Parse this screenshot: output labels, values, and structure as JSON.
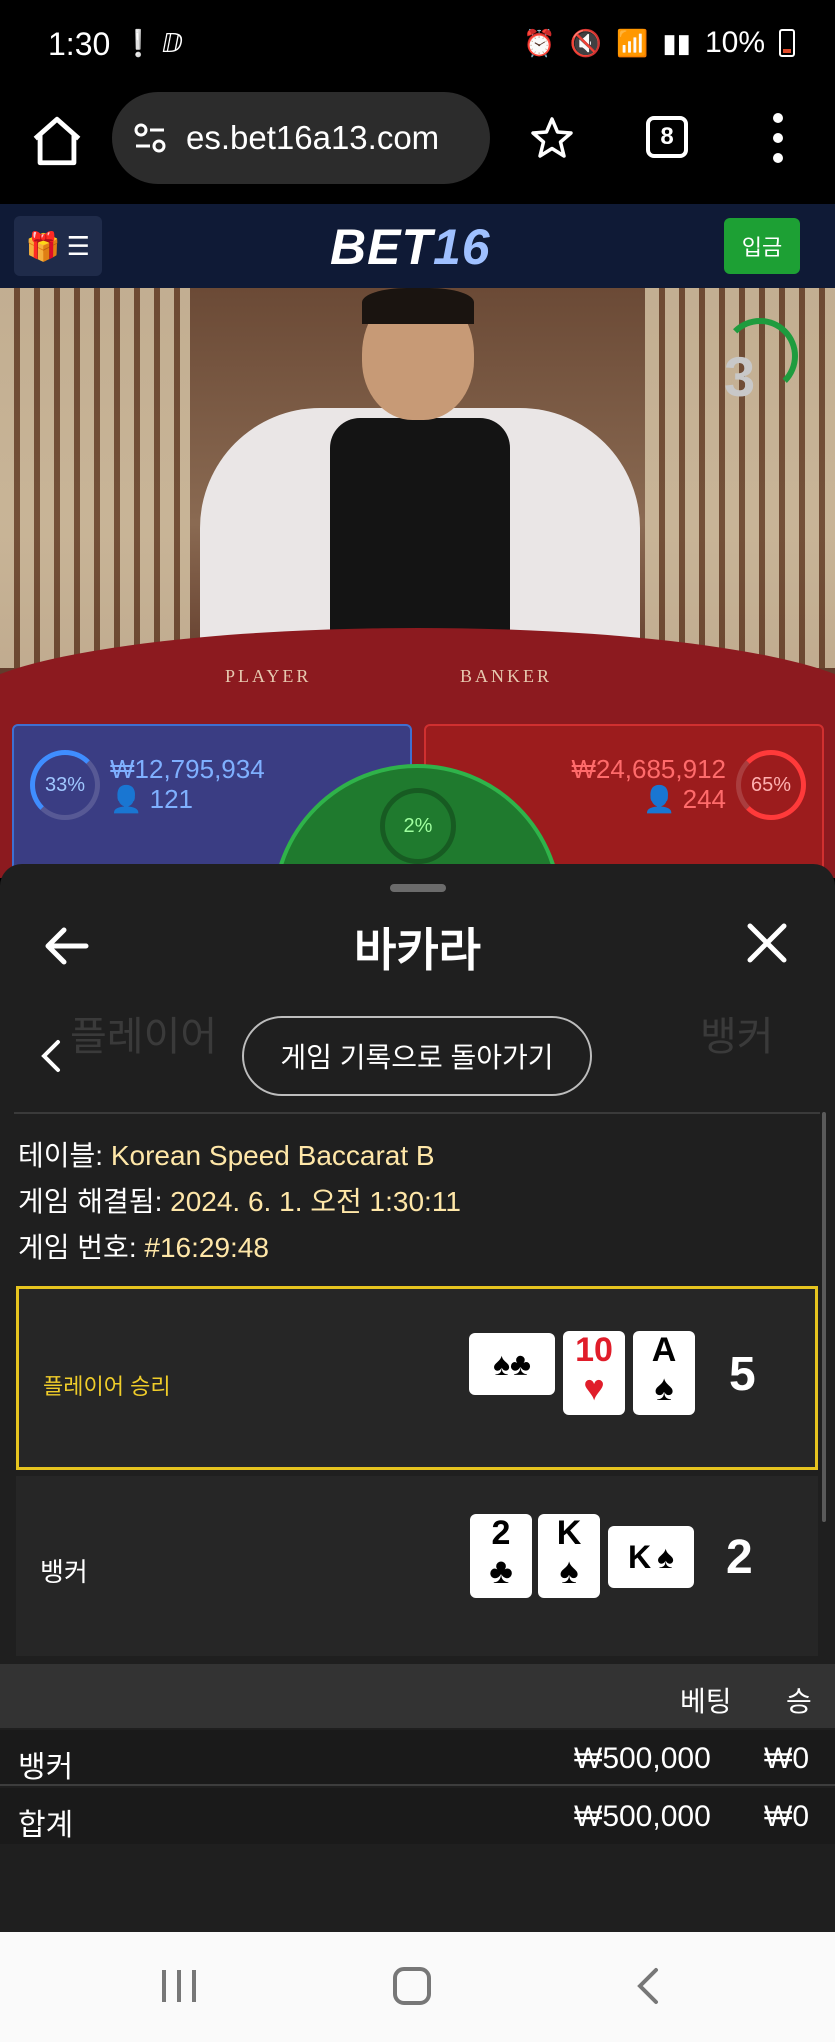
{
  "status_bar": {
    "time": "1:30",
    "battery": "10%"
  },
  "browser": {
    "url": "es.bet16a13.com",
    "tab_count": "8"
  },
  "site": {
    "logo_part1": "BET",
    "logo_part2": "16",
    "deposit_label": "입금"
  },
  "live_game": {
    "countdown": "3",
    "table_label_player": "PLAYER",
    "table_label_banker": "BANKER",
    "player_pct": "33%",
    "player_amount": "₩12,795,934",
    "player_count": "121",
    "banker_pct": "65%",
    "banker_amount": "₩24,685,912",
    "banker_count": "244",
    "tie_pct": "2%"
  },
  "sheet": {
    "title": "바카라",
    "back_history_label": "게임 기록으로 돌아가기",
    "info": {
      "table_label": "테이블:",
      "table_value": "Korean Speed Baccarat B",
      "resolved_label": "게임 해결됨:",
      "resolved_value": "2024. 6. 1. 오전 1:30:11",
      "game_no_label": "게임 번호:",
      "game_no_value": "#16:29:48"
    },
    "player_hand": {
      "label": "플레이어 승리",
      "score": "5",
      "cards": [
        {
          "rank": "",
          "suit": "♠♣",
          "orientation": "side",
          "color": "black"
        },
        {
          "rank": "10",
          "suit": "♥",
          "orientation": "up",
          "color": "red"
        },
        {
          "rank": "A",
          "suit": "♠",
          "orientation": "up",
          "color": "black"
        }
      ]
    },
    "banker_hand": {
      "label": "뱅커",
      "score": "2",
      "cards": [
        {
          "rank": "2",
          "suit": "♣",
          "orientation": "up",
          "color": "black"
        },
        {
          "rank": "K",
          "suit": "♠",
          "orientation": "up",
          "color": "black"
        },
        {
          "rank": "K",
          "suit": "♠",
          "orientation": "side",
          "color": "black"
        }
      ]
    },
    "bets_table": {
      "headers": [
        "베팅",
        "승"
      ],
      "rows": [
        {
          "label": "뱅커",
          "bet": "₩500,000",
          "win": "₩0"
        },
        {
          "label": "합계",
          "bet": "₩500,000",
          "win": "₩0"
        }
      ]
    }
  }
}
